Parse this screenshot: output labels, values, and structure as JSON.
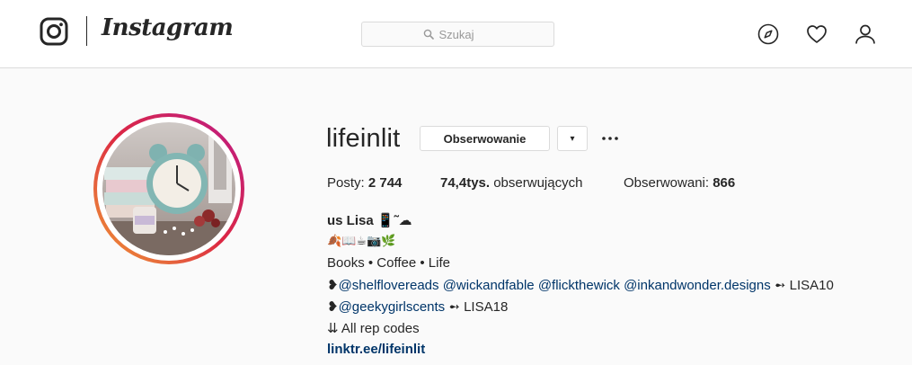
{
  "header": {
    "brand": "Instagram",
    "search": {
      "placeholder": "Szukaj"
    },
    "nav_icons": [
      "compass-icon",
      "heart-icon",
      "user-icon"
    ]
  },
  "profile": {
    "username": "lifeinlit",
    "follow_label": "Obserwowanie",
    "dropdown_label": "▾",
    "more_label": "...",
    "stats": {
      "posts_label": "Posty: ",
      "posts_value": "2 744",
      "followers_value": "74,4tys.",
      "followers_label": " obserwujących",
      "following_label": "Obserwowani: ",
      "following_value": "866"
    },
    "bio": {
      "name": "us Lisa 📱˜☁",
      "emoji_line": "🍂📖☕📷🌿",
      "line1": "Books • Coffee • Life",
      "line2_prefix": "❥",
      "line2_mentions": [
        "@shelflovereads",
        "@wickandfable",
        "@flickthewick",
        "@inkandwonder.designs"
      ],
      "line2_suffix": " ➻ LISA10",
      "line3_prefix": "❥",
      "line3_mention": "@geekygirlscents",
      "line3_suffix": " ➻ LISA18",
      "line4": "⇊ All rep codes",
      "link": "linktr.ee/lifeinlit"
    }
  },
  "colors": {
    "link": "#003569",
    "border": "#dbdbdb",
    "text": "#262626",
    "ring_start": "#f09433",
    "ring_end": "#bc1888"
  }
}
